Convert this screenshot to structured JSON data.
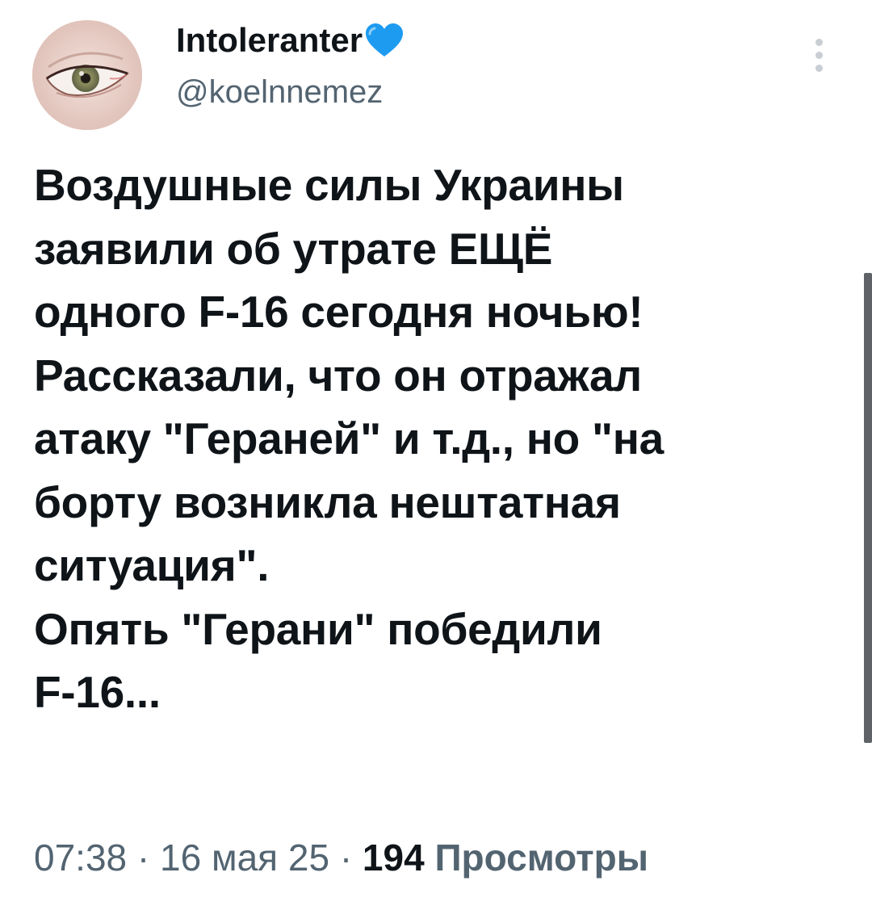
{
  "author": {
    "display_name": "Intoleranter",
    "handle": "@koelnnemez",
    "badge_icon": "blue-heart-icon",
    "badge_color": "#1d9bf0"
  },
  "tweet": {
    "lines": [
      "Воздушные силы Украины",
      "заявили об утрате ЕЩЁ",
      "одного F-16 сегодня ночью!",
      "Рассказали, что он отражал",
      "атаку \"Гераней\" и т.д., но \"на",
      "борту возникла нештатная",
      "ситуация\".",
      "Опять \"Герани\" победили",
      "F-16..."
    ]
  },
  "meta": {
    "time": "07:38",
    "separator": "·",
    "date": "16 мая 25",
    "views_count": "194",
    "views_label": "Просмотры"
  },
  "colors": {
    "text_primary": "#0f1419",
    "text_secondary": "#536471",
    "background": "#ffffff"
  }
}
